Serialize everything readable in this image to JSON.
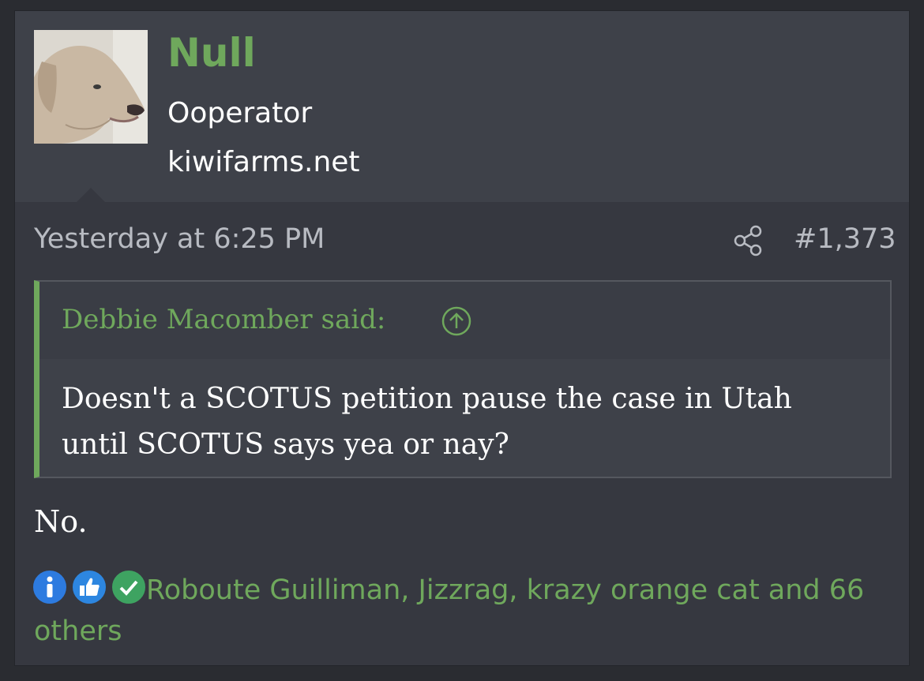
{
  "user": {
    "name": "Null",
    "title": "Ooperator",
    "site": "kiwifarms.net",
    "avatar_icon": "dog-avatar"
  },
  "post": {
    "date": "Yesterday at 6:25 PM",
    "number": "#1,373",
    "share_icon": "share-icon"
  },
  "quote": {
    "author": "Debbie Macomber said:",
    "body": "Doesn't a SCOTUS petition pause the case in Utah until SCOTUS says yea or nay?",
    "expand_icon": "arrow-up-circle-icon"
  },
  "message": "No.",
  "reactions": {
    "icons": [
      "info-icon",
      "thumbs-up-icon",
      "check-icon"
    ],
    "text": "Roboute Guilliman, Jizzrag, krazy orange cat and 66 others"
  },
  "colors": {
    "accent": "#6fa85c",
    "background": "#363840",
    "header": "#3e4149",
    "text": "#ffffff",
    "muted": "#b8bbc2"
  }
}
